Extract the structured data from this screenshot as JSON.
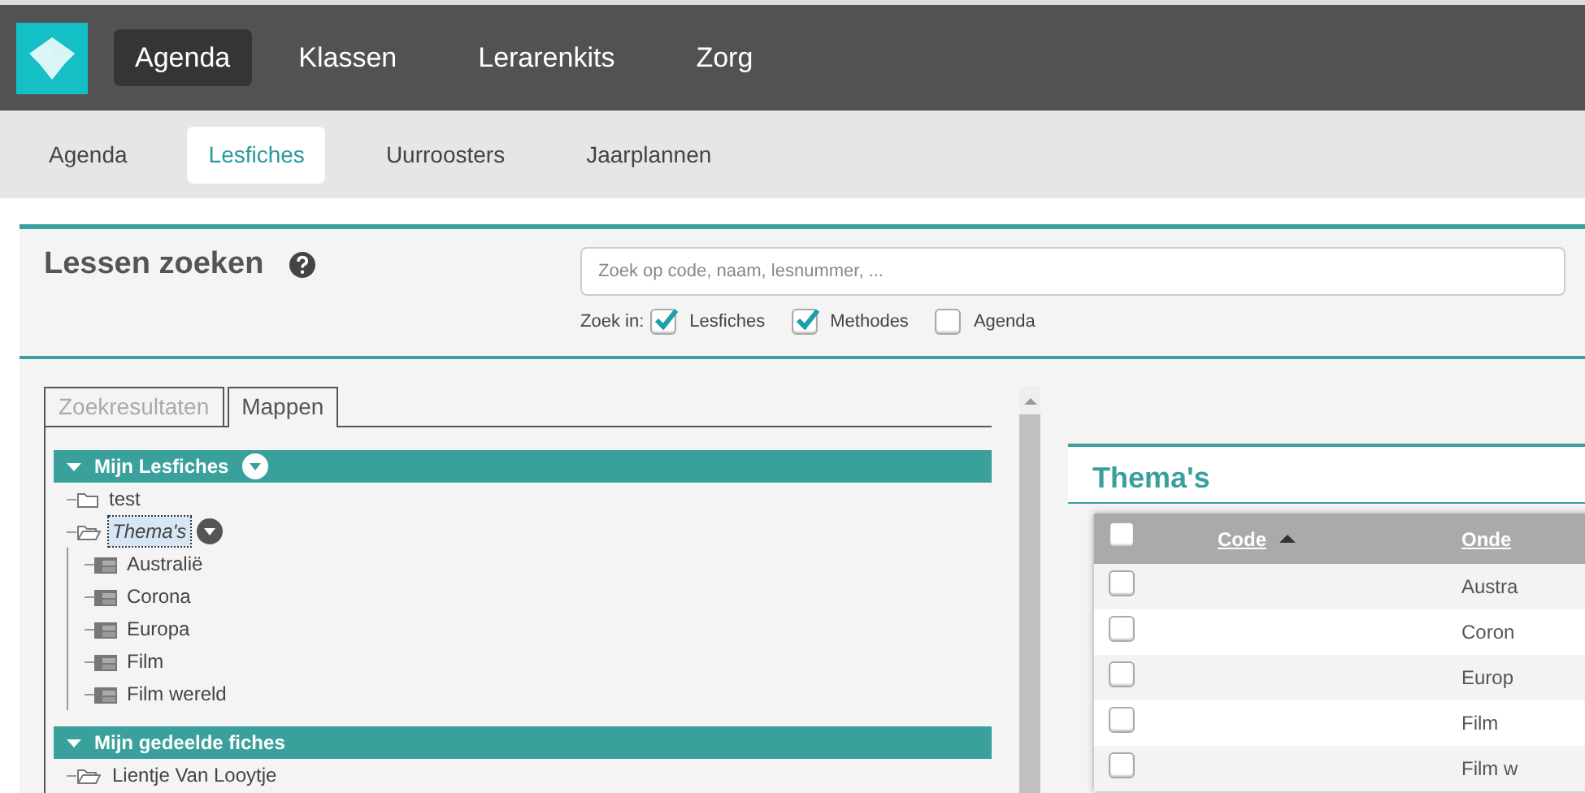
{
  "top_nav": {
    "items": [
      {
        "label": "Agenda",
        "selected": true
      },
      {
        "label": "Klassen",
        "selected": false
      },
      {
        "label": "Lerarenkits",
        "selected": false
      },
      {
        "label": "Zorg",
        "selected": false
      }
    ]
  },
  "sub_nav": {
    "items": [
      {
        "label": "Agenda",
        "selected": false
      },
      {
        "label": "Lesfiches",
        "selected": true
      },
      {
        "label": "Uurroosters",
        "selected": false
      },
      {
        "label": "Jaarplannen",
        "selected": false
      }
    ]
  },
  "search_panel": {
    "title": "Lessen zoeken",
    "search": {
      "placeholder": "Zoek op code, naam, lesnummer, ..."
    },
    "filter_label": "Zoek in:",
    "filters": [
      {
        "label": "Lesfiches",
        "checked": true
      },
      {
        "label": "Methodes",
        "checked": true
      },
      {
        "label": "Agenda",
        "checked": false
      }
    ]
  },
  "tree_panel": {
    "tabs": [
      {
        "label": "Zoekresultaten",
        "selected": false
      },
      {
        "label": "Mappen",
        "selected": true
      }
    ],
    "sections": [
      {
        "title": "Mijn Lesfiches",
        "menu": true,
        "expanded": true,
        "children": [
          {
            "label": "test",
            "kind": "folder",
            "expanded": false,
            "selected": false,
            "menu": false
          },
          {
            "label": "Thema's",
            "kind": "folder",
            "expanded": true,
            "selected": true,
            "menu": true,
            "children": [
              {
                "label": "Australië",
                "kind": "sheet",
                "selected": false,
                "menu": false
              },
              {
                "label": "Corona",
                "kind": "sheet",
                "selected": false,
                "menu": false
              },
              {
                "label": "Europa",
                "kind": "sheet",
                "selected": false,
                "menu": false
              },
              {
                "label": "Film",
                "kind": "sheet",
                "selected": false,
                "menu": false
              },
              {
                "label": "Film wereld",
                "kind": "sheet",
                "selected": false,
                "menu": false
              }
            ]
          }
        ]
      },
      {
        "title": "Mijn gedeelde fiches",
        "menu": false,
        "expanded": true,
        "children": [
          {
            "label": "Lientje Van Looytje",
            "kind": "folder",
            "expanded": true,
            "selected": false,
            "menu": false
          }
        ]
      }
    ]
  },
  "content_panel": {
    "title": "Thema's",
    "table": {
      "header_checked": false,
      "columns": [
        {
          "label": "Code",
          "sorted_ascending": true
        },
        {
          "label": "Onde",
          "sorted_ascending": false
        }
      ],
      "rows": [
        {
          "checked": false,
          "column_2": "Austra"
        },
        {
          "checked": false,
          "column_2": "Coron"
        },
        {
          "checked": false,
          "column_2": "Europ"
        },
        {
          "checked": false,
          "column_2": "Film"
        },
        {
          "checked": false,
          "column_2": "Film w"
        }
      ]
    }
  }
}
